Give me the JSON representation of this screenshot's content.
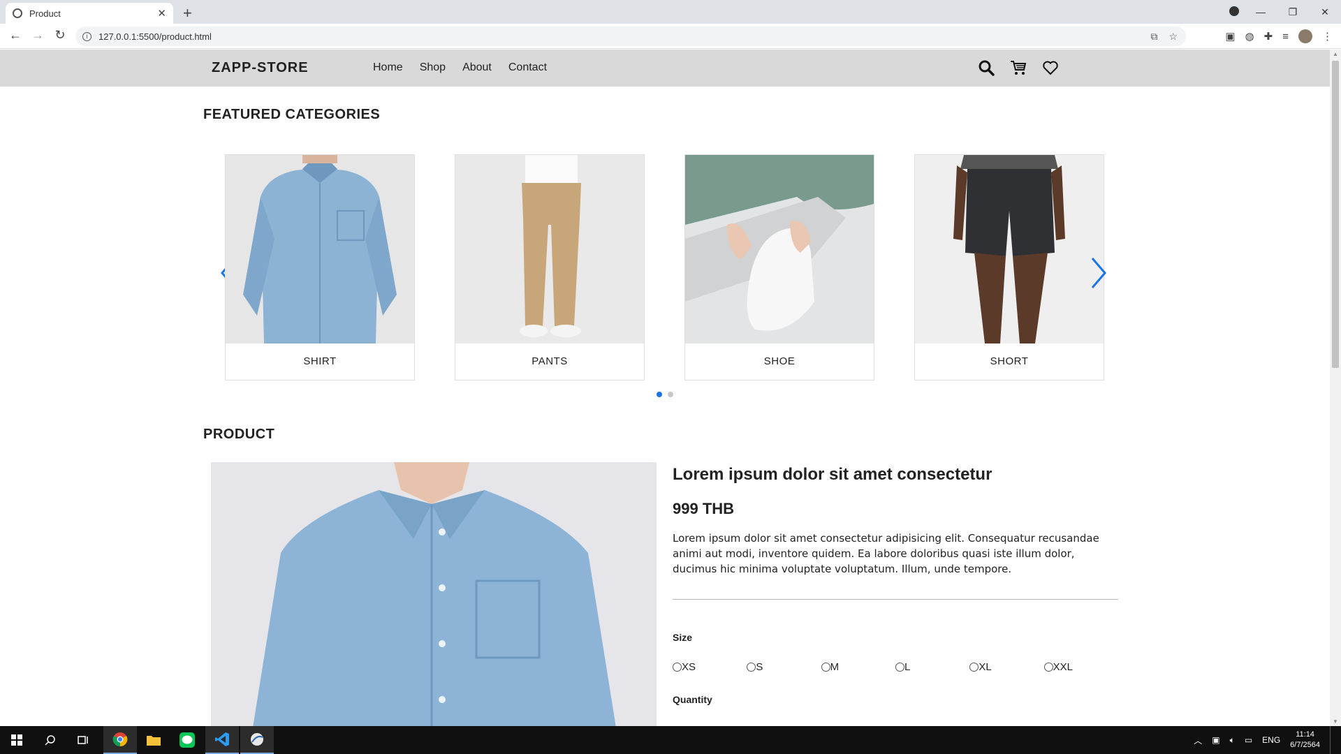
{
  "browser": {
    "tab_title": "Product",
    "url": "127.0.0.1:5500/product.html"
  },
  "site": {
    "brand": "ZAPP-STORE",
    "nav": [
      "Home",
      "Shop",
      "About",
      "Contact"
    ]
  },
  "featured": {
    "title": "FEATURED CATEGORIES",
    "categories": [
      "SHIRT",
      "PANTS",
      "SHOE",
      "SHORT"
    ],
    "slide_count": 2,
    "active_slide": 1
  },
  "product": {
    "section_title": "PRODUCT",
    "name": "Lorem ipsum dolor sit amet consectetur",
    "price": "999 THB",
    "description": "Lorem ipsum dolor sit amet consectetur adipisicing elit. Consequatur recusandae animi aut modi, inventore quidem. Ea labore doloribus quasi iste illum dolor, ducimus hic minima voluptate voluptatum. Illum, unde tempore.",
    "size_label": "Size",
    "sizes": [
      "XS",
      "S",
      "M",
      "L",
      "XL",
      "XXL"
    ],
    "quantity_label": "Quantity"
  },
  "taskbar": {
    "language": "ENG",
    "time": "11:14",
    "date": "6/7/2564"
  },
  "colors": {
    "accent": "#1a73e8",
    "header_bg": "#d9d9d9"
  }
}
